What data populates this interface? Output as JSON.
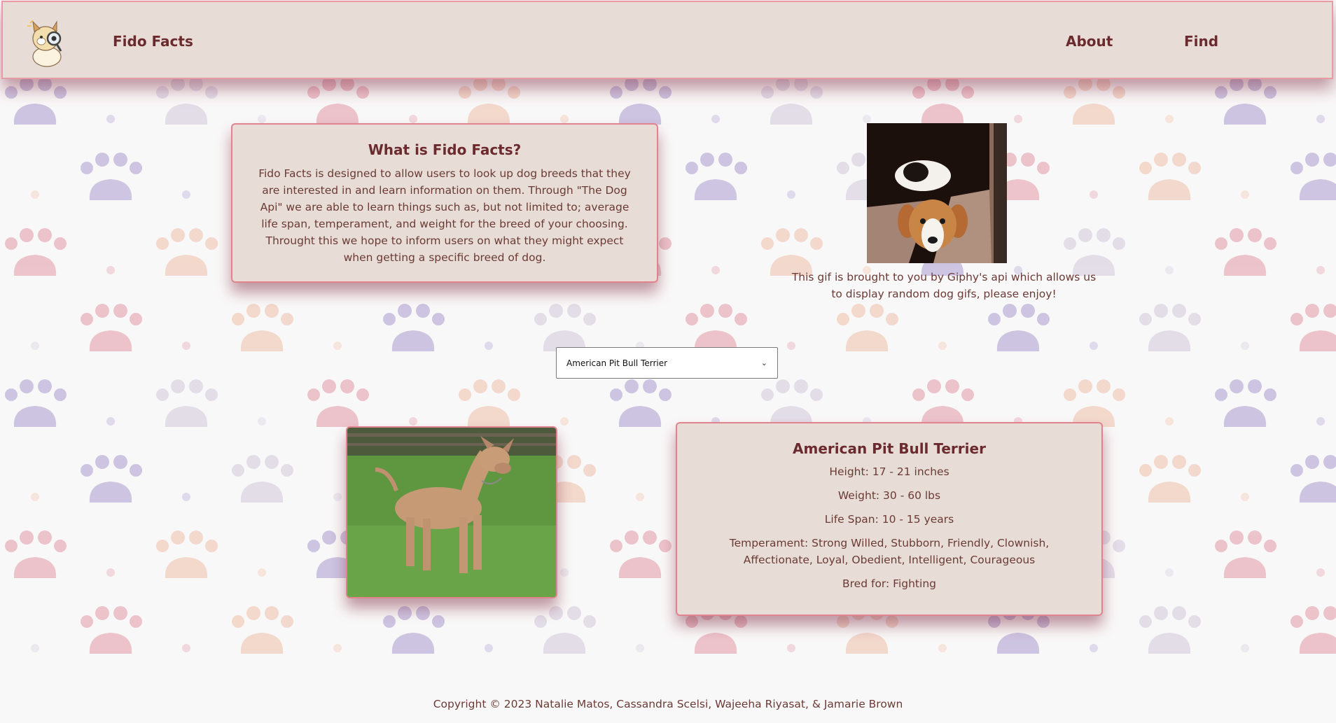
{
  "header": {
    "brand": "Fido Facts",
    "nav": [
      {
        "label": "About"
      },
      {
        "label": "Find"
      }
    ]
  },
  "about": {
    "title": "What is Fido Facts?",
    "body": "Fido Facts is designed to allow users to look up dog breeds that they are interested in and learn information on them. Through \"The Dog Api\" we are able to learn things such as, but not limited to; average life span, temperament, and weight for the breed of your choosing. Throught this we hope to inform users on what they might expect when getting a specific breed of dog."
  },
  "gif": {
    "caption": "This gif is brought to you by Giphy's api which allows us to display random dog gifs, please enjoy!"
  },
  "breed_select": {
    "selected": "American Pit Bull Terrier"
  },
  "breed": {
    "name": "American Pit Bull Terrier",
    "height": "Height: 17 - 21 inches",
    "weight": "Weight: 30 - 60 lbs",
    "life_span": "Life Span: 10 - 15 years",
    "temperament": "Temperament: Strong Willed, Stubborn, Friendly, Clownish, Affectionate, Loyal, Obedient, Intelligent, Courageous",
    "bred_for": "Bred for: Fighting"
  },
  "footer": {
    "copyright": "Copyright © 2023 Natalie Matos, Cassandra Scelsi, Wajeeha Riyasat, & Jamarie Brown"
  },
  "colors": {
    "header_bg": "#e7ddd6",
    "card_border": "#e0838f",
    "text": "#6b3a35",
    "paw_colors": [
      "#b7a9d6",
      "#d8cfe0",
      "#e7a7b4",
      "#f0c8b5"
    ]
  }
}
